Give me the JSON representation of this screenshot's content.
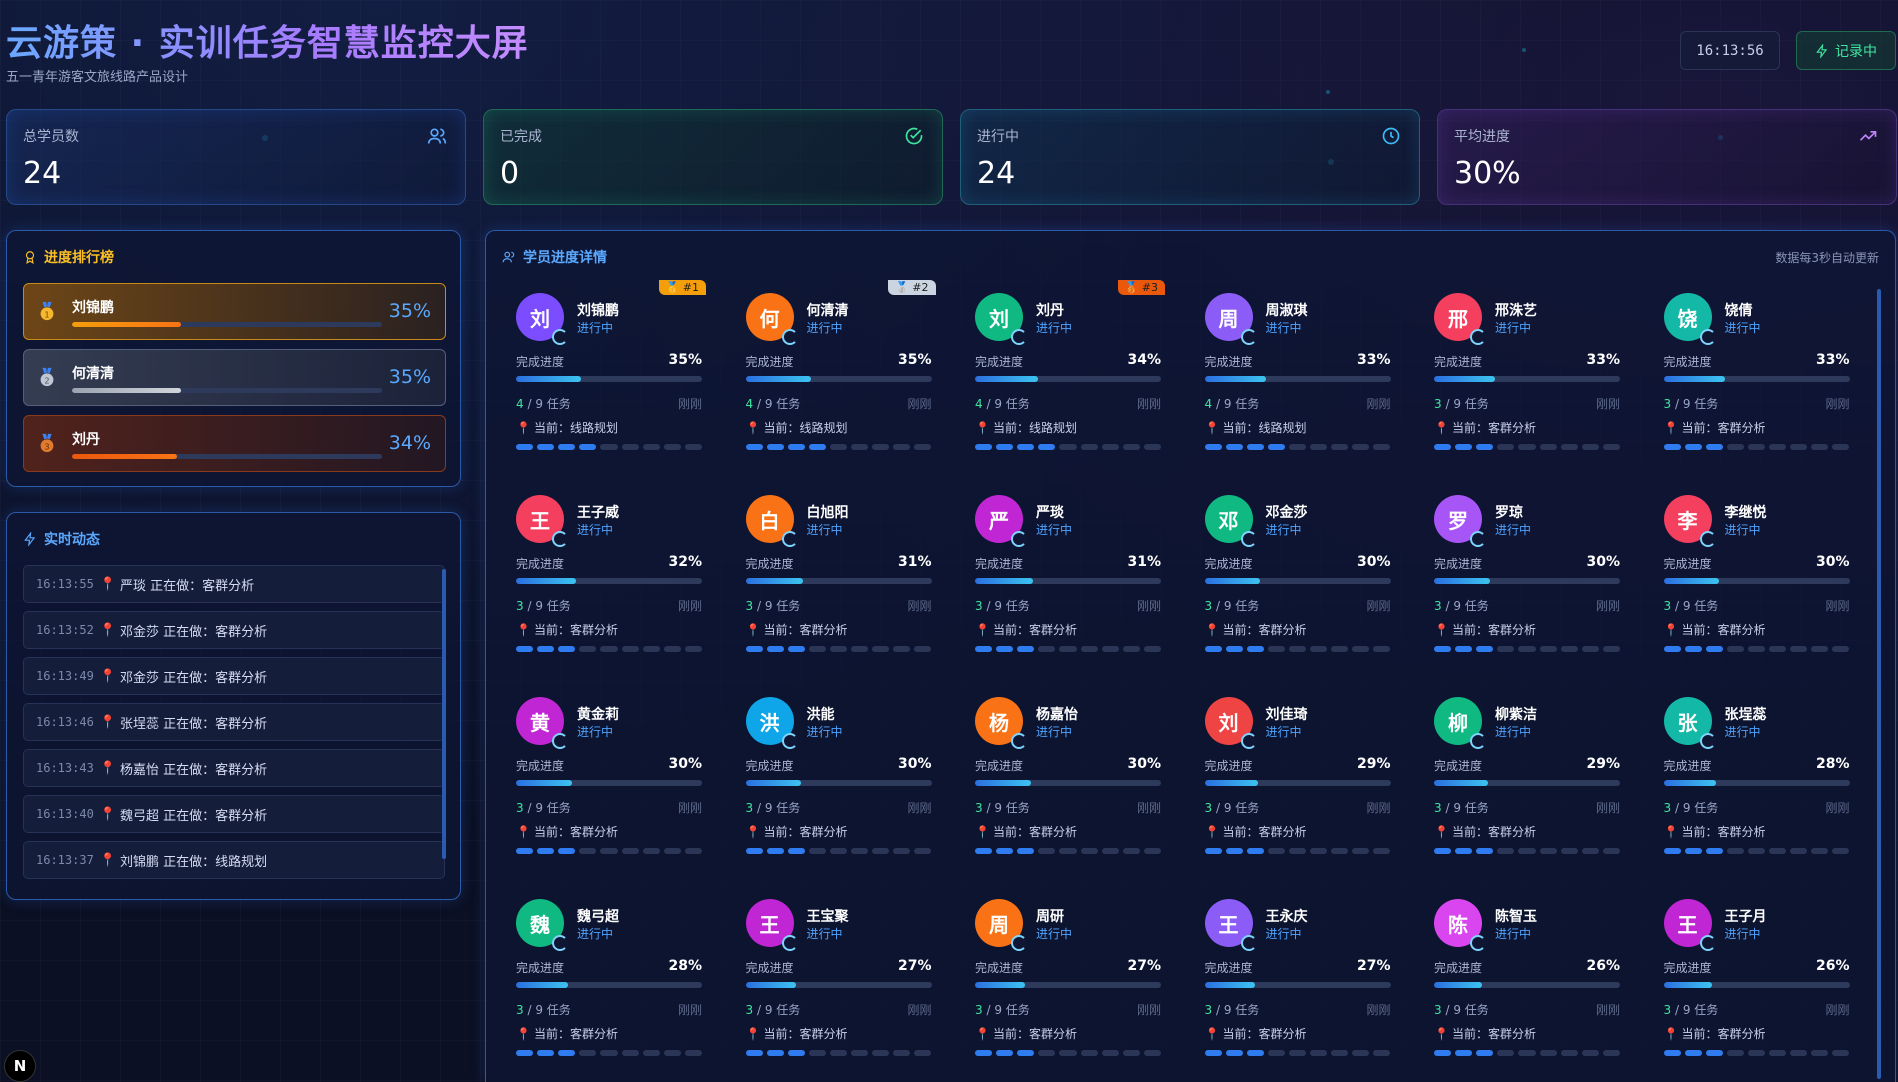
{
  "header": {
    "title": "云游策 · 实训任务智慧监控大屏",
    "subtitle": "五一青年游客文旅线路产品设计",
    "clock": "16:13:56",
    "record_label": "记录中"
  },
  "stats": [
    {
      "label": "总学员数",
      "value": "24",
      "icon": "users-icon"
    },
    {
      "label": "已完成",
      "value": "0",
      "icon": "check-circle-icon"
    },
    {
      "label": "进行中",
      "value": "24",
      "icon": "clock-icon"
    },
    {
      "label": "平均进度",
      "value": "30%",
      "icon": "trending-up-icon"
    }
  ],
  "ranking": {
    "title": "进度排行榜",
    "items": [
      {
        "name": "刘锦鹏",
        "pct": "35%",
        "progress": 35
      },
      {
        "name": "何清清",
        "pct": "35%",
        "progress": 35
      },
      {
        "name": "刘丹",
        "pct": "34%",
        "progress": 34
      }
    ]
  },
  "feed": {
    "title": "实时动态",
    "items": [
      {
        "time": "16:13:55",
        "text": "严琰 正在做：客群分析"
      },
      {
        "time": "16:13:52",
        "text": "邓金莎 正在做：客群分析"
      },
      {
        "time": "16:13:49",
        "text": "邓金莎 正在做：客群分析"
      },
      {
        "time": "16:13:46",
        "text": "张埕蕊 正在做：客群分析"
      },
      {
        "time": "16:13:43",
        "text": "杨嘉怡 正在做：客群分析"
      },
      {
        "time": "16:13:40",
        "text": "魏弓超 正在做：客群分析"
      },
      {
        "time": "16:13:37",
        "text": "刘锦鹏 正在做：线路规划"
      }
    ]
  },
  "detail": {
    "title": "学员进度详情",
    "auto_update": "数据每3秒自动更新",
    "progress_label": "完成进度",
    "tasks_suffix": " / 9 任务",
    "time_label": "刚刚",
    "current_prefix": "当前：",
    "status": "进行中",
    "students": [
      {
        "initial": "刘",
        "name": "刘锦鹏",
        "pct": "35%",
        "progress": 35,
        "done": "4",
        "current": "线路规划",
        "color": "#7c4dff",
        "badge": "🥇 #1"
      },
      {
        "initial": "何",
        "name": "何清清",
        "pct": "35%",
        "progress": 35,
        "done": "4",
        "current": "线路规划",
        "color": "#f97316",
        "badge": "🥈 #2"
      },
      {
        "initial": "刘",
        "name": "刘丹",
        "pct": "34%",
        "progress": 34,
        "done": "4",
        "current": "线路规划",
        "color": "#10b981",
        "badge": "🥉 #3"
      },
      {
        "initial": "周",
        "name": "周淑琪",
        "pct": "33%",
        "progress": 33,
        "done": "4",
        "current": "线路规划",
        "color": "#8b5cf6",
        "badge": ""
      },
      {
        "initial": "邢",
        "name": "邢洙艺",
        "pct": "33%",
        "progress": 33,
        "done": "3",
        "current": "客群分析",
        "color": "#f43f5e",
        "badge": ""
      },
      {
        "initial": "饶",
        "name": "饶倩",
        "pct": "33%",
        "progress": 33,
        "done": "3",
        "current": "客群分析",
        "color": "#14b8a6",
        "badge": ""
      },
      {
        "initial": "王",
        "name": "王子威",
        "pct": "32%",
        "progress": 32,
        "done": "3",
        "current": "客群分析",
        "color": "#f43f5e",
        "badge": ""
      },
      {
        "initial": "白",
        "name": "白旭阳",
        "pct": "31%",
        "progress": 31,
        "done": "3",
        "current": "客群分析",
        "color": "#f97316",
        "badge": ""
      },
      {
        "initial": "严",
        "name": "严琰",
        "pct": "31%",
        "progress": 31,
        "done": "3",
        "current": "客群分析",
        "color": "#c026d3",
        "badge": ""
      },
      {
        "initial": "邓",
        "name": "邓金莎",
        "pct": "30%",
        "progress": 30,
        "done": "3",
        "current": "客群分析",
        "color": "#10b981",
        "badge": ""
      },
      {
        "initial": "罗",
        "name": "罗琼",
        "pct": "30%",
        "progress": 30,
        "done": "3",
        "current": "客群分析",
        "color": "#a855f7",
        "badge": ""
      },
      {
        "initial": "李",
        "name": "李继悦",
        "pct": "30%",
        "progress": 30,
        "done": "3",
        "current": "客群分析",
        "color": "#f43f5e",
        "badge": ""
      },
      {
        "initial": "黄",
        "name": "黄金莉",
        "pct": "30%",
        "progress": 30,
        "done": "3",
        "current": "客群分析",
        "color": "#c026d3",
        "badge": ""
      },
      {
        "initial": "洪",
        "name": "洪能",
        "pct": "30%",
        "progress": 30,
        "done": "3",
        "current": "客群分析",
        "color": "#0ea5e9",
        "badge": ""
      },
      {
        "initial": "杨",
        "name": "杨嘉怡",
        "pct": "30%",
        "progress": 30,
        "done": "3",
        "current": "客群分析",
        "color": "#f97316",
        "badge": ""
      },
      {
        "initial": "刘",
        "name": "刘佳琦",
        "pct": "29%",
        "progress": 29,
        "done": "3",
        "current": "客群分析",
        "color": "#ef4444",
        "badge": ""
      },
      {
        "initial": "柳",
        "name": "柳紫洁",
        "pct": "29%",
        "progress": 29,
        "done": "3",
        "current": "客群分析",
        "color": "#10b981",
        "badge": ""
      },
      {
        "initial": "张",
        "name": "张埕蕊",
        "pct": "28%",
        "progress": 28,
        "done": "3",
        "current": "客群分析",
        "color": "#14b8a6",
        "badge": ""
      },
      {
        "initial": "魏",
        "name": "魏弓超",
        "pct": "28%",
        "progress": 28,
        "done": "3",
        "current": "客群分析",
        "color": "#10b981",
        "badge": ""
      },
      {
        "initial": "王",
        "name": "王宝聚",
        "pct": "27%",
        "progress": 27,
        "done": "3",
        "current": "客群分析",
        "color": "#c026d3",
        "badge": ""
      },
      {
        "initial": "周",
        "name": "周研",
        "pct": "27%",
        "progress": 27,
        "done": "3",
        "current": "客群分析",
        "color": "#f97316",
        "badge": ""
      },
      {
        "initial": "王",
        "name": "王永庆",
        "pct": "27%",
        "progress": 27,
        "done": "3",
        "current": "客群分析",
        "color": "#8b5cf6",
        "badge": ""
      },
      {
        "initial": "陈",
        "name": "陈智玉",
        "pct": "26%",
        "progress": 26,
        "done": "3",
        "current": "客群分析",
        "color": "#d946ef",
        "badge": ""
      },
      {
        "initial": "王",
        "name": "王子月",
        "pct": "26%",
        "progress": 26,
        "done": "3",
        "current": "客群分析",
        "color": "#c026d3",
        "badge": ""
      }
    ]
  },
  "colors": {
    "accent": "#5aa9ff",
    "gold": "#fbbf24",
    "green": "#3ee6a0"
  },
  "nav_button": "N"
}
